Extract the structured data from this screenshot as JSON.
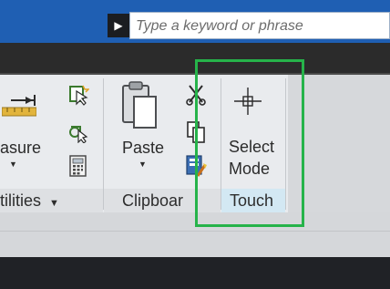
{
  "search": {
    "placeholder": "Type a keyword or phrase",
    "arrow_icon": "triangle-right"
  },
  "ribbon": {
    "measure_partial_label": "asure",
    "utilities_partial_label": "tilities",
    "clipboard": {
      "panel_label": "Clipboar",
      "paste_label": "Paste",
      "icons": [
        "cut-icon",
        "copy-icon",
        "match-properties-icon"
      ]
    },
    "touch": {
      "panel_label": "Touch",
      "select_mode_line1": "Select",
      "select_mode_line2": "Mode"
    },
    "utilities_icons": [
      "quick-select-icon",
      "select-similar-icon",
      "calculator-icon"
    ]
  },
  "colors": {
    "title_bar": "#1f5fb3",
    "tab_strip": "#2b2b2b",
    "ribbon_bg": "#e9ebee",
    "touch_panel": "#d3e8f3",
    "highlight": "#26b34a"
  }
}
